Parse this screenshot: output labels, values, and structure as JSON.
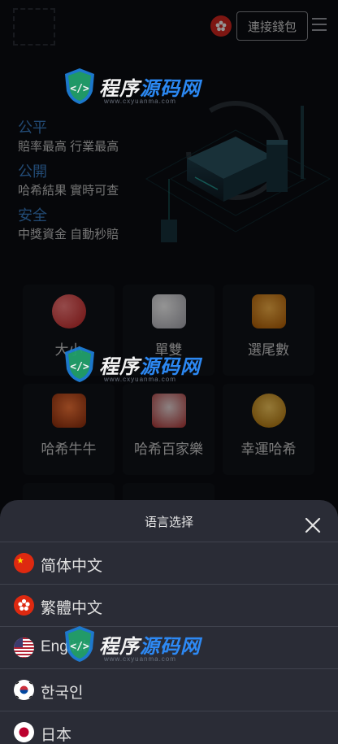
{
  "header": {
    "connect_wallet": "連接錢包",
    "flag_icon": "hong-kong-flag-icon",
    "menu_icon": "hamburger-menu-icon"
  },
  "hero": {
    "items": [
      {
        "title": "公平",
        "desc": "賠率最高 行業最高"
      },
      {
        "title": "公開",
        "desc": "哈希結果 實時可查"
      },
      {
        "title": "安全",
        "desc": "中獎資金 自動秒賠"
      }
    ]
  },
  "games": [
    {
      "label": "大小",
      "icon": "billiard-balls-icon"
    },
    {
      "label": "單雙",
      "icon": "dice-icon"
    },
    {
      "label": "選尾數",
      "icon": "slot-machine-icon"
    },
    {
      "label": "哈希牛牛",
      "icon": "bull-cards-icon"
    },
    {
      "label": "哈希百家樂",
      "icon": "playing-cards-icon"
    },
    {
      "label": "幸運哈希",
      "icon": "lucky-coin-icon"
    }
  ],
  "watermark": {
    "text_a": "程序",
    "text_b": "源码网",
    "sub": "www.cxyuanma.com"
  },
  "language_sheet": {
    "title": "语言选择",
    "options": [
      {
        "label": "简体中文",
        "flag": "china-flag-icon"
      },
      {
        "label": "繁體中文",
        "flag": "hong-kong-flag-icon"
      },
      {
        "label": "English",
        "flag": "usa-flag-icon"
      },
      {
        "label": "한국인",
        "flag": "korea-flag-icon"
      },
      {
        "label": "日本",
        "flag": "japan-flag-icon"
      }
    ]
  },
  "colors": {
    "accent_blue": "#3c80c8",
    "sheet_bg": "#2a2c36",
    "page_bg": "#0b0d12"
  }
}
